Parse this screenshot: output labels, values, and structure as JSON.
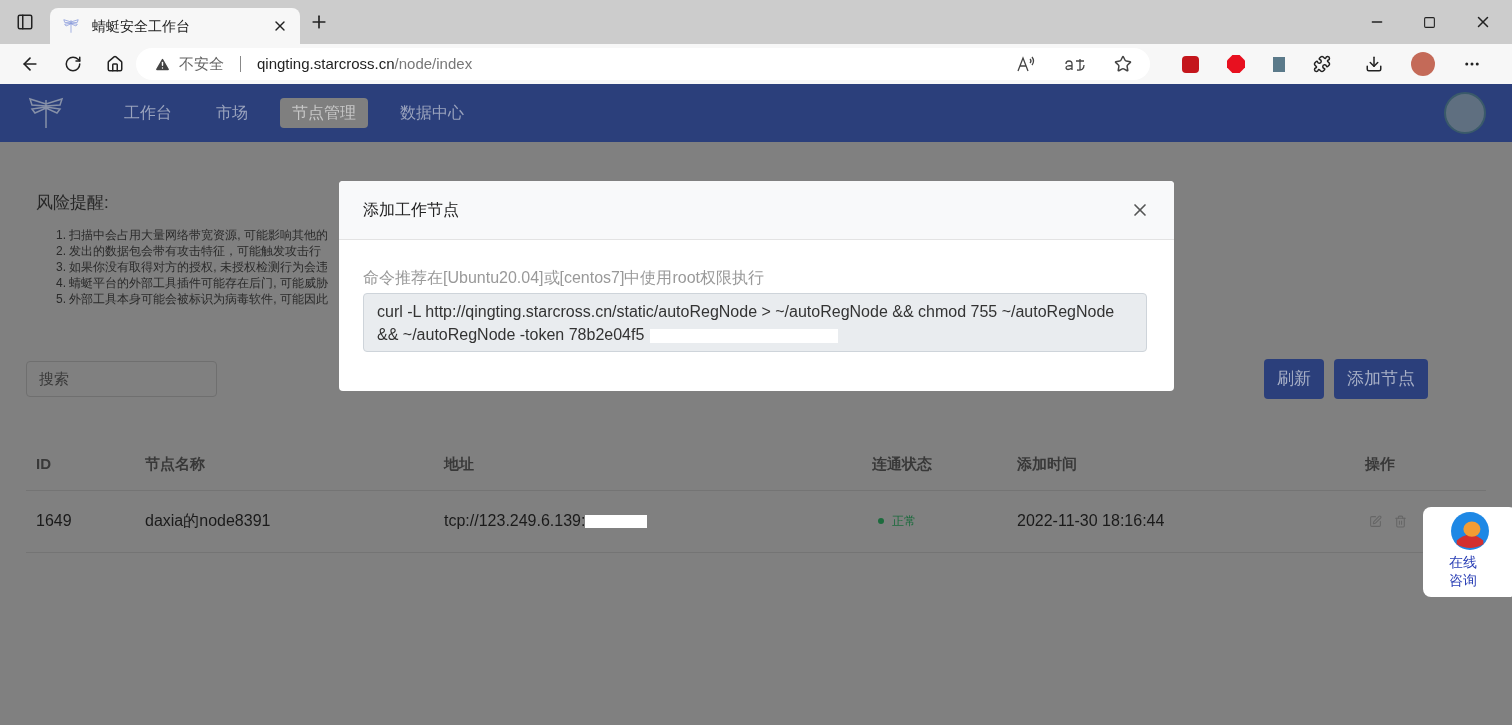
{
  "browser": {
    "tab_title": "蜻蜓安全工作台",
    "security": "不安全",
    "url_host": "qingting.starcross.cn",
    "url_path": "/node/index"
  },
  "nav": [
    {
      "label": "工作台",
      "selected": false
    },
    {
      "label": "市场",
      "selected": false
    },
    {
      "label": "节点管理",
      "selected": true
    },
    {
      "label": "数据中心",
      "selected": false
    }
  ],
  "risk": {
    "title": "风险提醒:",
    "items": [
      "1. 扫描中会占用大量网络带宽资源, 可能影响其他的",
      "2. 发出的数据包会带有攻击特征，可能触发攻击行",
      "3. 如果你没有取得对方的授权, 未授权检测行为会违",
      "4. 蜻蜓平台的外部工具插件可能存在后门, 可能威胁",
      "5. 外部工具本身可能会被标识为病毒软件, 可能因此"
    ]
  },
  "search": {
    "placeholder": "搜索"
  },
  "buttons": [
    "刷新",
    "添加节点"
  ],
  "table": {
    "columns": [
      "ID",
      "节点名称",
      "地址",
      "连通状态",
      "添加时间",
      "操作"
    ],
    "rows": [
      {
        "id": "1649",
        "name": "daxia的node8391",
        "address": "tcp://123.249.6.139:",
        "status": {
          "label": "正常",
          "kind": "ok"
        },
        "added": "2022-11-30 18:16:44"
      }
    ]
  },
  "modal": {
    "title": "添加工作节点",
    "hint": "命令推荐在[Ubuntu20.04]或[centos7]中使用root权限执行",
    "command": "curl -L http://qingting.starcross.cn/static/autoRegNode > ~/autoRegNode && chmod 755 ~/autoRegNode && ~/autoRegNode -token 78b2e04f5"
  },
  "chat_widget": {
    "label": "在线咨询"
  }
}
